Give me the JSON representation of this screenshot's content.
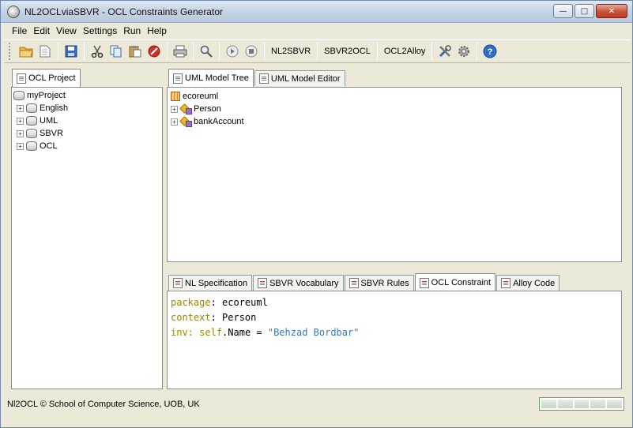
{
  "window": {
    "title": "NL2OCLviaSBVR - OCL Constraints Generator",
    "buttons": {
      "minimize": "—",
      "maximize": "□",
      "close": "✕"
    }
  },
  "menubar": {
    "items": [
      "File",
      "Edit",
      "View",
      "Settings",
      "Run",
      "Help"
    ]
  },
  "toolbar": {
    "icons": [
      "open-folder-icon",
      "new-file-icon",
      "save-icon",
      "cut-icon",
      "copy-icon",
      "paste-icon",
      "stop-red-icon",
      "print-icon",
      "search-icon",
      "play-icon",
      "stop-icon"
    ],
    "nl2sbvr": "NL2SBVR",
    "sbvr2ocl": "SBVR2OCL",
    "ocl2alloy": "OCL2Alloy"
  },
  "left_panel": {
    "tab": "OCL Project",
    "tree": {
      "root": "myProject",
      "children": [
        "English",
        "UML",
        "SBVR",
        "OCL"
      ]
    }
  },
  "model_panel": {
    "tabs": [
      "UML Model Tree",
      "UML Model Editor"
    ],
    "tree": {
      "root": "ecoreuml",
      "children": [
        "Person",
        "bankAccount"
      ]
    }
  },
  "output_panel": {
    "tabs": [
      "NL Specification",
      "SBVR Vocabulary",
      "SBVR Rules",
      "OCL Constraint",
      "Alloy Code"
    ],
    "active_tab": "OCL Constraint",
    "code": {
      "line1_kw": "package",
      "line1_rest": ": ecoreuml",
      "line2_kw": "context",
      "line2_rest": ": Person",
      "line3_kw1": "inv",
      "line3_sep": ": ",
      "line3_kw2": "self",
      "line3_mid": ".Name = ",
      "line3_str": "\"Behzad Bordbar\""
    }
  },
  "status": {
    "text": "Nl2OCL © School of Computer Science, UOB, UK"
  },
  "colors": {
    "keyword": "#9b8a00",
    "string": "#3a7ab8"
  }
}
